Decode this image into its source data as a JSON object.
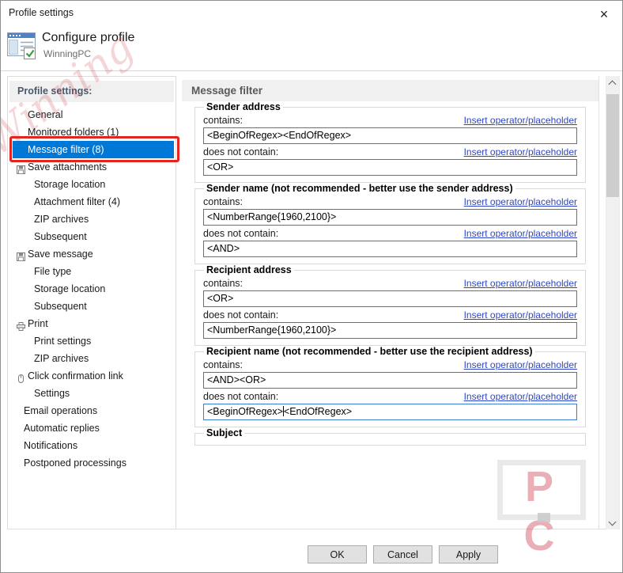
{
  "window": {
    "title": "Profile settings",
    "close_glyph": "×"
  },
  "header": {
    "title": "Configure profile",
    "subtitle": "WinningPC"
  },
  "colors": {
    "accent": "#0078d7",
    "link": "#2e46c8",
    "annotation": "#e2251d"
  },
  "sidebar": {
    "title": "Profile settings:",
    "items": [
      {
        "label": "General",
        "level": 1
      },
      {
        "label": "Monitored folders (1)",
        "level": 1
      },
      {
        "label": "Message filter (8)",
        "level": 1,
        "selected": true,
        "annotated": true
      },
      {
        "label": "Save attachments",
        "level": 1,
        "icon": "save-icon"
      },
      {
        "label": "Storage location",
        "level": 2
      },
      {
        "label": "Attachment filter (4)",
        "level": 2
      },
      {
        "label": "ZIP archives",
        "level": 2
      },
      {
        "label": "Subsequent",
        "level": 2
      },
      {
        "label": "Save message",
        "level": 1,
        "icon": "save-icon"
      },
      {
        "label": "File type",
        "level": 2
      },
      {
        "label": "Storage location",
        "level": 2
      },
      {
        "label": "Subsequent",
        "level": 2
      },
      {
        "label": "Print",
        "level": 1,
        "icon": "printer-icon"
      },
      {
        "label": "Print settings",
        "level": 2
      },
      {
        "label": "ZIP archives",
        "level": 2
      },
      {
        "label": "Click confirmation link",
        "level": 1,
        "icon": "mouse-icon"
      },
      {
        "label": "Settings",
        "level": 2
      },
      {
        "label": "Email operations",
        "level": 0
      },
      {
        "label": "Automatic replies",
        "level": 0
      },
      {
        "label": "Notifications",
        "level": 0
      },
      {
        "label": "Postponed processings",
        "level": 0
      }
    ]
  },
  "main": {
    "title": "Message filter",
    "insert_link": "Insert operator/placeholder",
    "groups": [
      {
        "title": "Sender address",
        "fields": [
          {
            "label": "contains:",
            "value": "<BeginOfRegex><EndOfRegex>"
          },
          {
            "label": "does not contain:",
            "value": "<OR>"
          }
        ]
      },
      {
        "title": "Sender name (not recommended - better use the sender address)",
        "fields": [
          {
            "label": "contains:",
            "value": "<NumberRange{1960,2100}>"
          },
          {
            "label": "does not contain:",
            "value": "<AND>"
          }
        ]
      },
      {
        "title": "Recipient address",
        "fields": [
          {
            "label": "contains:",
            "value": "<OR>"
          },
          {
            "label": "does not contain:",
            "value": "<NumberRange{1960,2100}>"
          }
        ]
      },
      {
        "title": "Recipient name (not recommended - better use the recipient address)",
        "fields": [
          {
            "label": "contains:",
            "value": "<AND><OR>"
          },
          {
            "label": "does not contain:",
            "focused": true,
            "value_pre": "<BeginOfRegex>",
            "value_post": "<EndOfRegex>"
          }
        ]
      },
      {
        "title": "Subject",
        "partial": true
      }
    ]
  },
  "footer": {
    "ok": "OK",
    "cancel": "Cancel",
    "apply": "Apply"
  },
  "watermark": {
    "script_text": "Winning",
    "logo_letters": "P C"
  }
}
